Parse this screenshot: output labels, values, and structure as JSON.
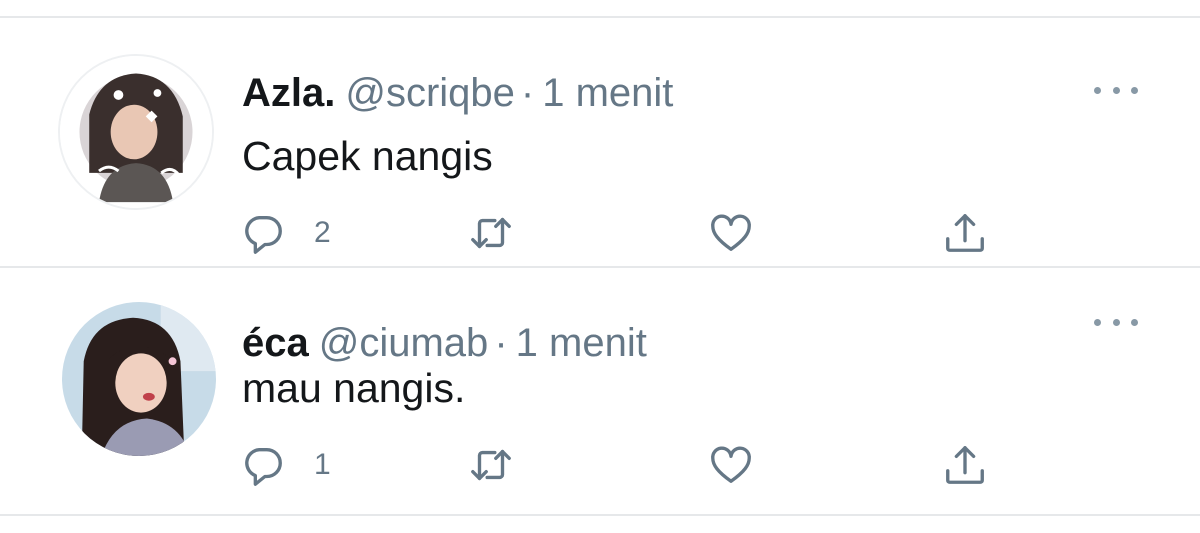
{
  "tweets": [
    {
      "name": "Azla.",
      "handle": "@scriqbe",
      "separator": "·",
      "time": "1 menit",
      "text": "Capek nangis",
      "reply_count": "2",
      "avatar_icon": "profile-photo"
    },
    {
      "name": "éca",
      "handle": "@ciumab",
      "separator": "·",
      "time": "1 menit",
      "text": "mau nangis.",
      "reply_count": "1",
      "avatar_icon": "profile-photo"
    }
  ],
  "icons": {
    "reply": "reply-icon",
    "retweet": "retweet-icon",
    "like": "heart-icon",
    "share": "share-icon",
    "more": "more-icon"
  },
  "colors": {
    "text_primary": "#14171a",
    "text_secondary": "#657786",
    "icon": "#657786",
    "divider": "#e6e8ea"
  }
}
